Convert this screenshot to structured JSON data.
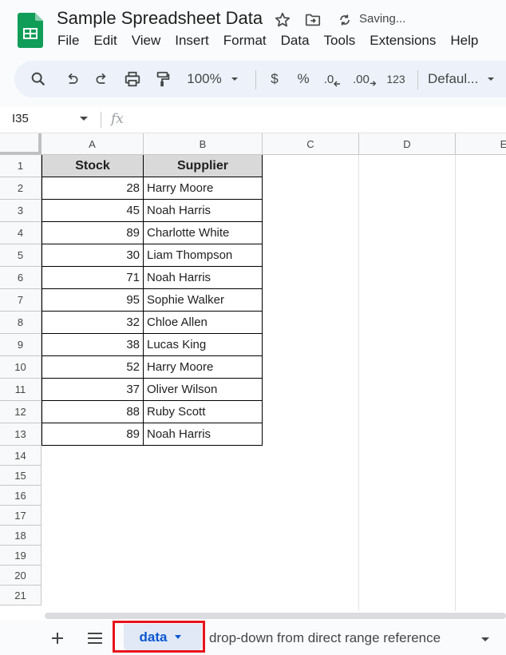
{
  "app": {
    "title": "Sample Spreadsheet Data",
    "status": "Saving...",
    "brand_color": "#0f9d58"
  },
  "menu": [
    "File",
    "Edit",
    "View",
    "Insert",
    "Format",
    "Data",
    "Tools",
    "Extensions",
    "Help"
  ],
  "toolbar": {
    "zoom": "100%",
    "currency": "$",
    "percent": "%",
    "decrease_decimal": ".0",
    "increase_decimal": ".00",
    "number_format": "123",
    "font": "Defaul..."
  },
  "formula_bar": {
    "cell_ref": "I35",
    "fx": "fx",
    "value": ""
  },
  "columns": [
    "A",
    "B",
    "C",
    "D",
    "E"
  ],
  "row_numbers": [
    "1",
    "2",
    "3",
    "4",
    "5",
    "6",
    "7",
    "8",
    "9",
    "10",
    "11",
    "12",
    "13",
    "14",
    "15",
    "16",
    "17",
    "18",
    "19",
    "20",
    "21"
  ],
  "table": {
    "headers": [
      "Stock",
      "Supplier"
    ],
    "rows": [
      [
        "28",
        "Harry Moore"
      ],
      [
        "45",
        "Noah Harris"
      ],
      [
        "89",
        "Charlotte White"
      ],
      [
        "30",
        "Liam Thompson"
      ],
      [
        "71",
        "Noah Harris"
      ],
      [
        "95",
        "Sophie Walker"
      ],
      [
        "32",
        "Chloe Allen"
      ],
      [
        "38",
        "Lucas King"
      ],
      [
        "52",
        "Harry Moore"
      ],
      [
        "37",
        "Oliver Wilson"
      ],
      [
        "88",
        "Ruby Scott"
      ],
      [
        "89",
        "Noah Harris"
      ]
    ]
  },
  "sheets": {
    "active": "data",
    "other": "drop-down from direct range reference",
    "highlight_color": "#e8121b"
  }
}
